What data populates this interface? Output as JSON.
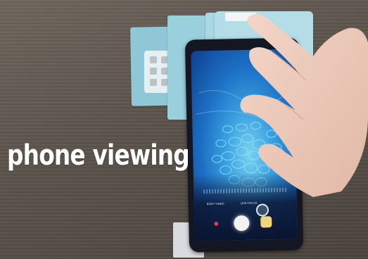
{
  "overlay": {
    "caption": "phone viewing"
  },
  "phone_ui": {
    "mode_left": "BODY VIDEO",
    "mode_right": "LIVE FOCUS"
  },
  "colors": {
    "screen_blue": "#2d8ad8",
    "shutter": "#f3f3f3",
    "record": "#e23b3b"
  }
}
